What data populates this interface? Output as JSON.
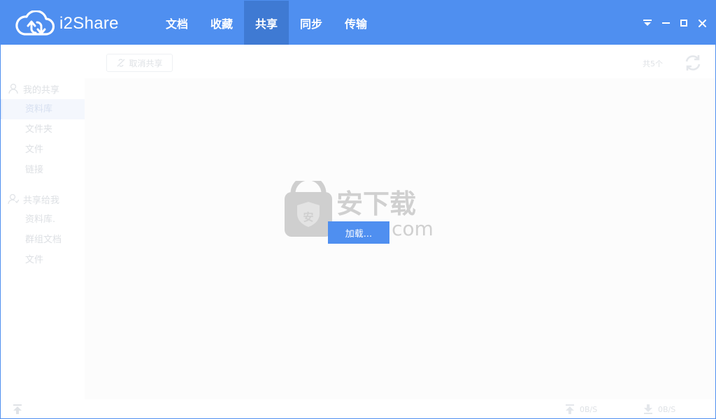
{
  "app": {
    "title": "i2Share"
  },
  "nav": {
    "tabs": [
      {
        "label": "文档",
        "active": false
      },
      {
        "label": "收藏",
        "active": false
      },
      {
        "label": "共享",
        "active": true
      },
      {
        "label": "同步",
        "active": false
      },
      {
        "label": "传输",
        "active": false
      }
    ]
  },
  "window_controls": [
    "menu-dropdown-icon",
    "minimize-icon",
    "maximize-icon",
    "close-icon"
  ],
  "toolbar": {
    "unshare_label": "取消共享",
    "count": "共5个"
  },
  "sidebar": {
    "my_share": {
      "title": "我的共享",
      "items": [
        {
          "label": "资料库",
          "active": true
        },
        {
          "label": "文件夹",
          "active": false
        },
        {
          "label": "文件",
          "active": false
        },
        {
          "label": "链接",
          "active": false
        }
      ]
    },
    "shared_to_me": {
      "title": "共享给我",
      "items": [
        {
          "label": "资料库.",
          "active": false
        },
        {
          "label": "群组文档",
          "active": false
        },
        {
          "label": "文件",
          "active": false
        }
      ]
    }
  },
  "overlay": {
    "loading_label": "加载...",
    "watermark_text": "安下载",
    "watermark_domain": "anxz.com",
    "watermark_badge": "安"
  },
  "status": {
    "upload_speed": "0B/S",
    "download_speed": "0B/S"
  },
  "colors": {
    "brand": "#4f8ff0",
    "brand_active": "#3f7ad3",
    "muted": "#dfe2e6"
  }
}
